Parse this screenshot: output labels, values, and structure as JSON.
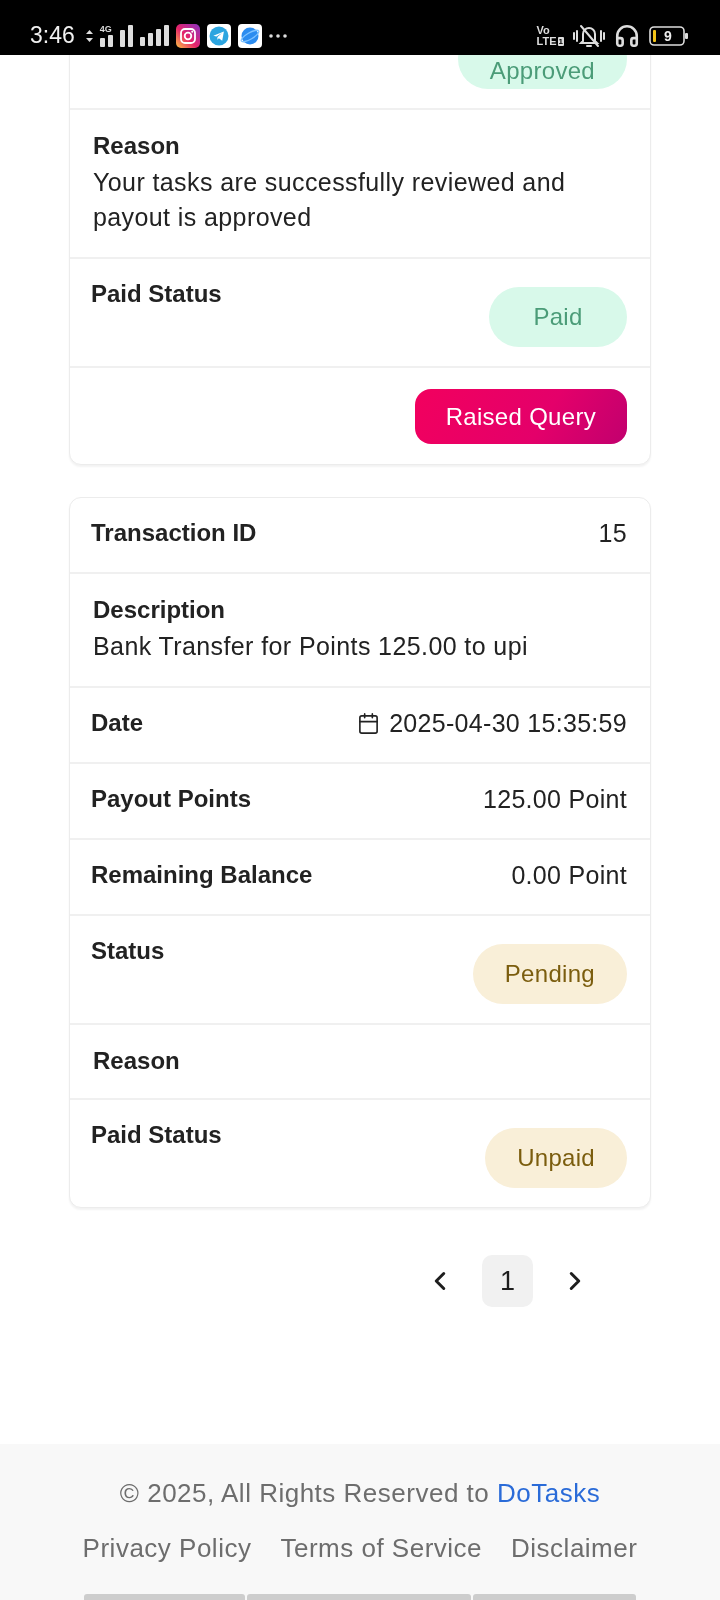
{
  "status_bar": {
    "time": "3:46",
    "network": "4G",
    "volte_top": "Vo",
    "volte_bottom": "LTE",
    "sim": "1",
    "battery": "9"
  },
  "cards": [
    {
      "rows": [
        {
          "kind": "badge",
          "badge": {
            "label": "Approved",
            "color": "#4b9c78"
          }
        },
        {
          "kind": "stacked",
          "label": "Reason",
          "value": "Your tasks are successfully reviewed and payout is approved"
        },
        {
          "kind": "badge",
          "label": "Paid Status",
          "badge": {
            "label": "Paid",
            "color": "#4b9c78"
          }
        }
      ],
      "action": {
        "label": "Raised Query"
      }
    },
    {
      "rows": [
        {
          "kind": "pair",
          "label": "Transaction ID",
          "value": "15"
        },
        {
          "kind": "stacked",
          "label": "Description",
          "value": "Bank Transfer for Points 125.00 to upi"
        },
        {
          "kind": "date",
          "label": "Date",
          "value": "2025-04-30 15:35:59"
        },
        {
          "kind": "pair",
          "label": "Payout Points",
          "value": "125.00 Point"
        },
        {
          "kind": "pair",
          "label": "Remaining Balance",
          "value": "0.00 Point"
        },
        {
          "kind": "badge",
          "label": "Status",
          "badge": {
            "label": "Pending",
            "color": "#7b5d0e"
          }
        },
        {
          "kind": "stacked",
          "label": "Reason"
        },
        {
          "kind": "badge",
          "label": "Paid Status",
          "badge": {
            "label": "Unpaid",
            "color": "#7b5d0e"
          }
        }
      ]
    }
  ],
  "pagination": {
    "pages": [
      {
        "label": "1",
        "selected": true
      }
    ]
  },
  "footer": {
    "copyright": "© 2025, All Rights Reserved to",
    "link": "DoTasks",
    "links": [
      "Privacy Policy",
      "Terms of Service",
      "Disclaimer"
    ]
  }
}
